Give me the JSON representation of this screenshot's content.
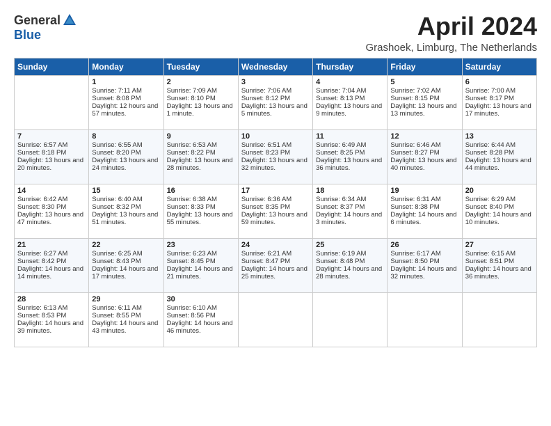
{
  "logo": {
    "general": "General",
    "blue": "Blue"
  },
  "title": "April 2024",
  "location": "Grashoek, Limburg, The Netherlands",
  "weekdays": [
    "Sunday",
    "Monday",
    "Tuesday",
    "Wednesday",
    "Thursday",
    "Friday",
    "Saturday"
  ],
  "weeks": [
    [
      {
        "day": "",
        "sunrise": "",
        "sunset": "",
        "daylight": ""
      },
      {
        "day": "1",
        "sunrise": "Sunrise: 7:11 AM",
        "sunset": "Sunset: 8:08 PM",
        "daylight": "Daylight: 12 hours and 57 minutes."
      },
      {
        "day": "2",
        "sunrise": "Sunrise: 7:09 AM",
        "sunset": "Sunset: 8:10 PM",
        "daylight": "Daylight: 13 hours and 1 minute."
      },
      {
        "day": "3",
        "sunrise": "Sunrise: 7:06 AM",
        "sunset": "Sunset: 8:12 PM",
        "daylight": "Daylight: 13 hours and 5 minutes."
      },
      {
        "day": "4",
        "sunrise": "Sunrise: 7:04 AM",
        "sunset": "Sunset: 8:13 PM",
        "daylight": "Daylight: 13 hours and 9 minutes."
      },
      {
        "day": "5",
        "sunrise": "Sunrise: 7:02 AM",
        "sunset": "Sunset: 8:15 PM",
        "daylight": "Daylight: 13 hours and 13 minutes."
      },
      {
        "day": "6",
        "sunrise": "Sunrise: 7:00 AM",
        "sunset": "Sunset: 8:17 PM",
        "daylight": "Daylight: 13 hours and 17 minutes."
      }
    ],
    [
      {
        "day": "7",
        "sunrise": "Sunrise: 6:57 AM",
        "sunset": "Sunset: 8:18 PM",
        "daylight": "Daylight: 13 hours and 20 minutes."
      },
      {
        "day": "8",
        "sunrise": "Sunrise: 6:55 AM",
        "sunset": "Sunset: 8:20 PM",
        "daylight": "Daylight: 13 hours and 24 minutes."
      },
      {
        "day": "9",
        "sunrise": "Sunrise: 6:53 AM",
        "sunset": "Sunset: 8:22 PM",
        "daylight": "Daylight: 13 hours and 28 minutes."
      },
      {
        "day": "10",
        "sunrise": "Sunrise: 6:51 AM",
        "sunset": "Sunset: 8:23 PM",
        "daylight": "Daylight: 13 hours and 32 minutes."
      },
      {
        "day": "11",
        "sunrise": "Sunrise: 6:49 AM",
        "sunset": "Sunset: 8:25 PM",
        "daylight": "Daylight: 13 hours and 36 minutes."
      },
      {
        "day": "12",
        "sunrise": "Sunrise: 6:46 AM",
        "sunset": "Sunset: 8:27 PM",
        "daylight": "Daylight: 13 hours and 40 minutes."
      },
      {
        "day": "13",
        "sunrise": "Sunrise: 6:44 AM",
        "sunset": "Sunset: 8:28 PM",
        "daylight": "Daylight: 13 hours and 44 minutes."
      }
    ],
    [
      {
        "day": "14",
        "sunrise": "Sunrise: 6:42 AM",
        "sunset": "Sunset: 8:30 PM",
        "daylight": "Daylight: 13 hours and 47 minutes."
      },
      {
        "day": "15",
        "sunrise": "Sunrise: 6:40 AM",
        "sunset": "Sunset: 8:32 PM",
        "daylight": "Daylight: 13 hours and 51 minutes."
      },
      {
        "day": "16",
        "sunrise": "Sunrise: 6:38 AM",
        "sunset": "Sunset: 8:33 PM",
        "daylight": "Daylight: 13 hours and 55 minutes."
      },
      {
        "day": "17",
        "sunrise": "Sunrise: 6:36 AM",
        "sunset": "Sunset: 8:35 PM",
        "daylight": "Daylight: 13 hours and 59 minutes."
      },
      {
        "day": "18",
        "sunrise": "Sunrise: 6:34 AM",
        "sunset": "Sunset: 8:37 PM",
        "daylight": "Daylight: 14 hours and 3 minutes."
      },
      {
        "day": "19",
        "sunrise": "Sunrise: 6:31 AM",
        "sunset": "Sunset: 8:38 PM",
        "daylight": "Daylight: 14 hours and 6 minutes."
      },
      {
        "day": "20",
        "sunrise": "Sunrise: 6:29 AM",
        "sunset": "Sunset: 8:40 PM",
        "daylight": "Daylight: 14 hours and 10 minutes."
      }
    ],
    [
      {
        "day": "21",
        "sunrise": "Sunrise: 6:27 AM",
        "sunset": "Sunset: 8:42 PM",
        "daylight": "Daylight: 14 hours and 14 minutes."
      },
      {
        "day": "22",
        "sunrise": "Sunrise: 6:25 AM",
        "sunset": "Sunset: 8:43 PM",
        "daylight": "Daylight: 14 hours and 17 minutes."
      },
      {
        "day": "23",
        "sunrise": "Sunrise: 6:23 AM",
        "sunset": "Sunset: 8:45 PM",
        "daylight": "Daylight: 14 hours and 21 minutes."
      },
      {
        "day": "24",
        "sunrise": "Sunrise: 6:21 AM",
        "sunset": "Sunset: 8:47 PM",
        "daylight": "Daylight: 14 hours and 25 minutes."
      },
      {
        "day": "25",
        "sunrise": "Sunrise: 6:19 AM",
        "sunset": "Sunset: 8:48 PM",
        "daylight": "Daylight: 14 hours and 28 minutes."
      },
      {
        "day": "26",
        "sunrise": "Sunrise: 6:17 AM",
        "sunset": "Sunset: 8:50 PM",
        "daylight": "Daylight: 14 hours and 32 minutes."
      },
      {
        "day": "27",
        "sunrise": "Sunrise: 6:15 AM",
        "sunset": "Sunset: 8:51 PM",
        "daylight": "Daylight: 14 hours and 36 minutes."
      }
    ],
    [
      {
        "day": "28",
        "sunrise": "Sunrise: 6:13 AM",
        "sunset": "Sunset: 8:53 PM",
        "daylight": "Daylight: 14 hours and 39 minutes."
      },
      {
        "day": "29",
        "sunrise": "Sunrise: 6:11 AM",
        "sunset": "Sunset: 8:55 PM",
        "daylight": "Daylight: 14 hours and 43 minutes."
      },
      {
        "day": "30",
        "sunrise": "Sunrise: 6:10 AM",
        "sunset": "Sunset: 8:56 PM",
        "daylight": "Daylight: 14 hours and 46 minutes."
      },
      {
        "day": "",
        "sunrise": "",
        "sunset": "",
        "daylight": ""
      },
      {
        "day": "",
        "sunrise": "",
        "sunset": "",
        "daylight": ""
      },
      {
        "day": "",
        "sunrise": "",
        "sunset": "",
        "daylight": ""
      },
      {
        "day": "",
        "sunrise": "",
        "sunset": "",
        "daylight": ""
      }
    ]
  ]
}
